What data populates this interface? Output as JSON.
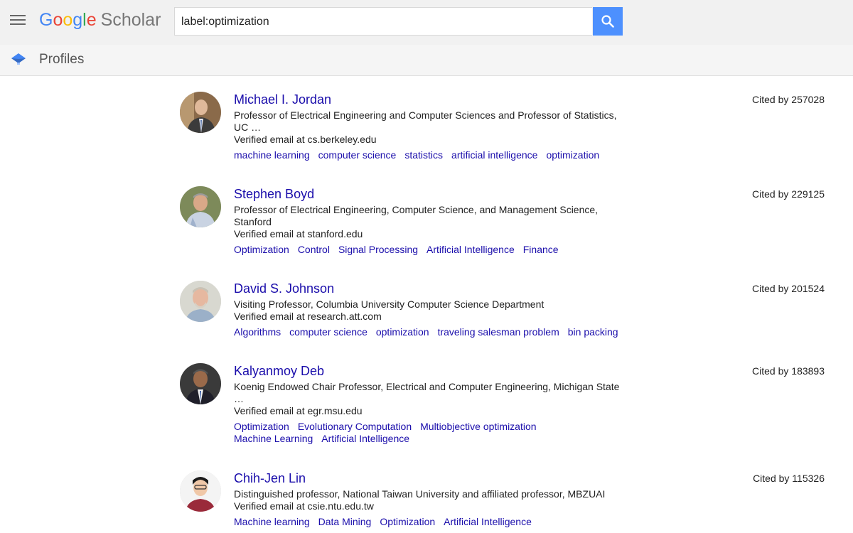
{
  "header": {
    "logo_letters": [
      "G",
      "o",
      "o",
      "g",
      "l",
      "e"
    ],
    "logo_suffix": "Scholar",
    "search_value": "label:optimization"
  },
  "subheader": {
    "title": "Profiles"
  },
  "colors": {
    "link": "#1a0dab",
    "accent": "#4d90fe"
  },
  "profiles": [
    {
      "name": "Michael I. Jordan",
      "affiliation": "Professor of Electrical Engineering and Computer Sciences and Professor of Statistics, UC …",
      "email": "Verified email at cs.berkeley.edu",
      "interests": [
        "machine learning",
        "computer science",
        "statistics",
        "artificial intelligence",
        "optimization"
      ],
      "cited": "Cited by 257028"
    },
    {
      "name": "Stephen Boyd",
      "affiliation": "Professor of Electrical Engineering, Computer Science, and Management Science, Stanford",
      "email": "Verified email at stanford.edu",
      "interests": [
        "Optimization",
        "Control",
        "Signal Processing",
        "Artificial Intelligence",
        "Finance"
      ],
      "cited": "Cited by 229125"
    },
    {
      "name": "David S. Johnson",
      "affiliation": "Visiting Professor, Columbia University Computer Science Department",
      "email": "Verified email at research.att.com",
      "interests": [
        "Algorithms",
        "computer science",
        "optimization",
        "traveling salesman problem",
        "bin packing"
      ],
      "cited": "Cited by 201524"
    },
    {
      "name": "Kalyanmoy Deb",
      "affiliation": "Koenig Endowed Chair Professor, Electrical and Computer Engineering, Michigan State …",
      "email": "Verified email at egr.msu.edu",
      "interests": [
        "Optimization",
        "Evolutionary Computation",
        "Multiobjective optimization",
        "Machine Learning",
        "Artificial Intelligence"
      ],
      "cited": "Cited by 183893"
    },
    {
      "name": "Chih-Jen Lin",
      "affiliation": "Distinguished professor, National Taiwan University and affiliated professor, MBZUAI",
      "email": "Verified email at csie.ntu.edu.tw",
      "interests": [
        "Machine learning",
        "Data Mining",
        "Optimization",
        "Artificial Intelligence"
      ],
      "cited": "Cited by 115326"
    }
  ]
}
